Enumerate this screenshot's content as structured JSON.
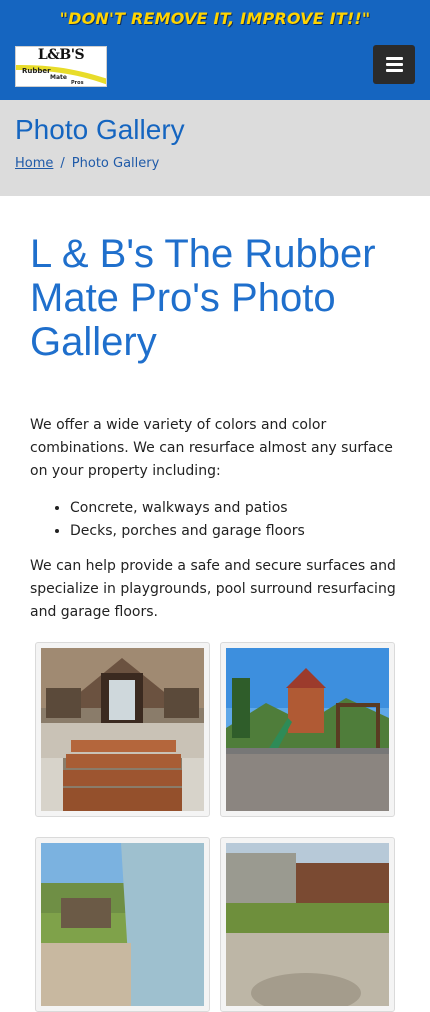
{
  "header": {
    "slogan": "\"DON'T REMOVE IT, IMPROVE IT!!\"",
    "logo": {
      "brand": "L&B'S",
      "line1": "Rubber",
      "line2": "Mate",
      "line3": "Pros"
    },
    "menu_icon": "hamburger-icon"
  },
  "title_bar": {
    "title": "Photo Gallery",
    "breadcrumb": {
      "home": "Home",
      "separator": "/",
      "current": "Photo Gallery"
    }
  },
  "main": {
    "heading": "L & B's The Rubber Mate Pro's Photo Gallery",
    "intro": "We offer a wide variety of colors and color combinations.  We can resurface almost any surface on your property including:",
    "bullets": [
      "Concrete, walkways and patios",
      "Decks, porches and garage floors"
    ],
    "closing": "We can help provide a safe and secure surfaces and specialize in playgrounds, pool surround resurfacing and garage floors."
  },
  "colors": {
    "header_blue": "#1565c0",
    "slogan_yellow": "#ffd400",
    "title_bg": "#dcdcdc",
    "heading_blue": "#1f6fcc"
  }
}
